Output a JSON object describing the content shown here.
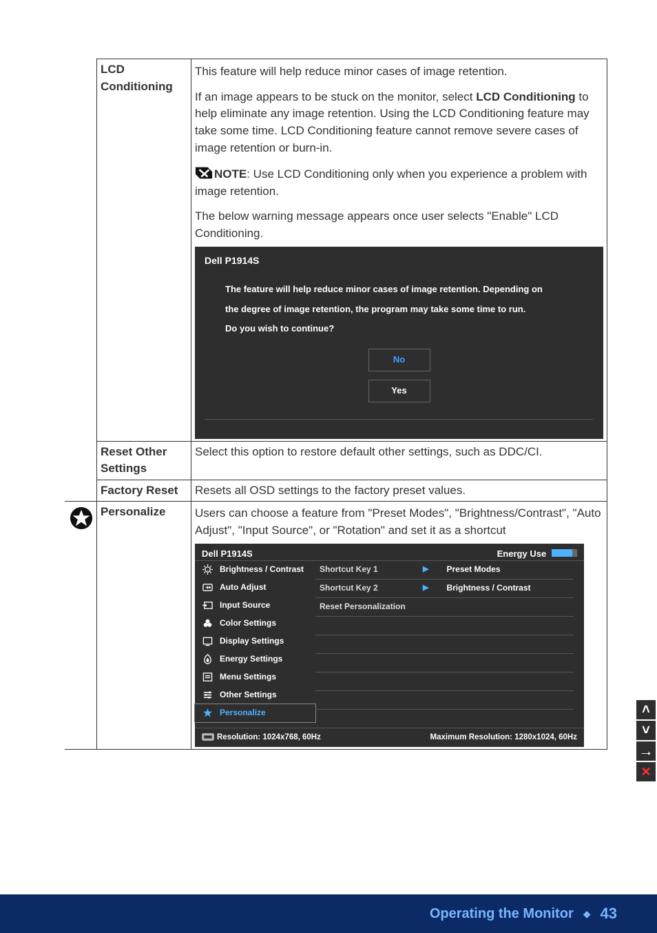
{
  "rows": {
    "lcd_conditioning": {
      "label_l1": "LCD",
      "label_l2": "Conditioning",
      "p1": "This feature will help reduce minor cases of image retention.",
      "p2a": "If an image appears to be stuck on the monitor, select ",
      "p2b_bold": "LCD Conditioning",
      "p2c": " to help eliminate any image retention. Using the LCD Conditioning feature may take some time. LCD Conditioning feature cannot remove  severe cases of image retention or burn-in.",
      "note_label": "NOTE",
      "note_text": ": Use LCD Conditioning only when you experience a problem with image retention.",
      "p3": "The below warning message appears once user selects \"Enable\" LCD Conditioning."
    },
    "reset_other": {
      "label_l1": "Reset Other",
      "label_l2": "Settings",
      "text": "Select this option to restore default other settings, such as DDC/CI."
    },
    "factory_reset": {
      "label": "Factory Reset",
      "text": "Resets all OSD settings to the factory preset values."
    },
    "personalize": {
      "label": "Personalize",
      "text": "Users can choose a feature from \"Preset Modes\", \"Brightness/Contrast\", \"Auto Adjust\", \"Input Source\", or \"Rotation\" and set it as a shortcut"
    }
  },
  "osd_dialog": {
    "title": "Dell P1914S",
    "line1": "The feature will help reduce minor cases of image retention. Depending on",
    "line2": "the degree of image retention, the program may take some time to run.",
    "line3": "Do you wish to continue?",
    "btn_no": "No",
    "btn_yes": "Yes"
  },
  "osd_menu": {
    "title": "Dell P1914S",
    "energy_label": "Energy Use",
    "left_items": [
      {
        "icon": "brightness-contrast-icon",
        "label": "Brightness / Contrast"
      },
      {
        "icon": "auto-adjust-icon",
        "label": "Auto Adjust"
      },
      {
        "icon": "input-source-icon",
        "label": "Input Source"
      },
      {
        "icon": "color-settings-icon",
        "label": "Color Settings"
      },
      {
        "icon": "display-settings-icon",
        "label": "Display Settings"
      },
      {
        "icon": "energy-settings-icon",
        "label": "Energy Settings"
      },
      {
        "icon": "menu-settings-icon",
        "label": "Menu Settings"
      },
      {
        "icon": "other-settings-icon",
        "label": "Other Settings"
      },
      {
        "icon": "personalize-icon",
        "label": "Personalize",
        "selected": true
      }
    ],
    "mid_items": [
      "Shortcut Key 1",
      "Shortcut Key 2",
      "Reset Personalization"
    ],
    "right_items": [
      {
        "label": "Preset Modes",
        "arrow": true
      },
      {
        "label": "Brightness / Contrast",
        "arrow": true
      }
    ],
    "foot_left": "Resolution: 1024x768,  60Hz",
    "foot_right": "Maximum Resolution: 1280x1024,  60Hz"
  },
  "side_buttons": {
    "up": "˄",
    "down": "˅",
    "right": "→",
    "close": "✕"
  },
  "footer": {
    "section": "Operating the Monitor",
    "page": "43"
  }
}
